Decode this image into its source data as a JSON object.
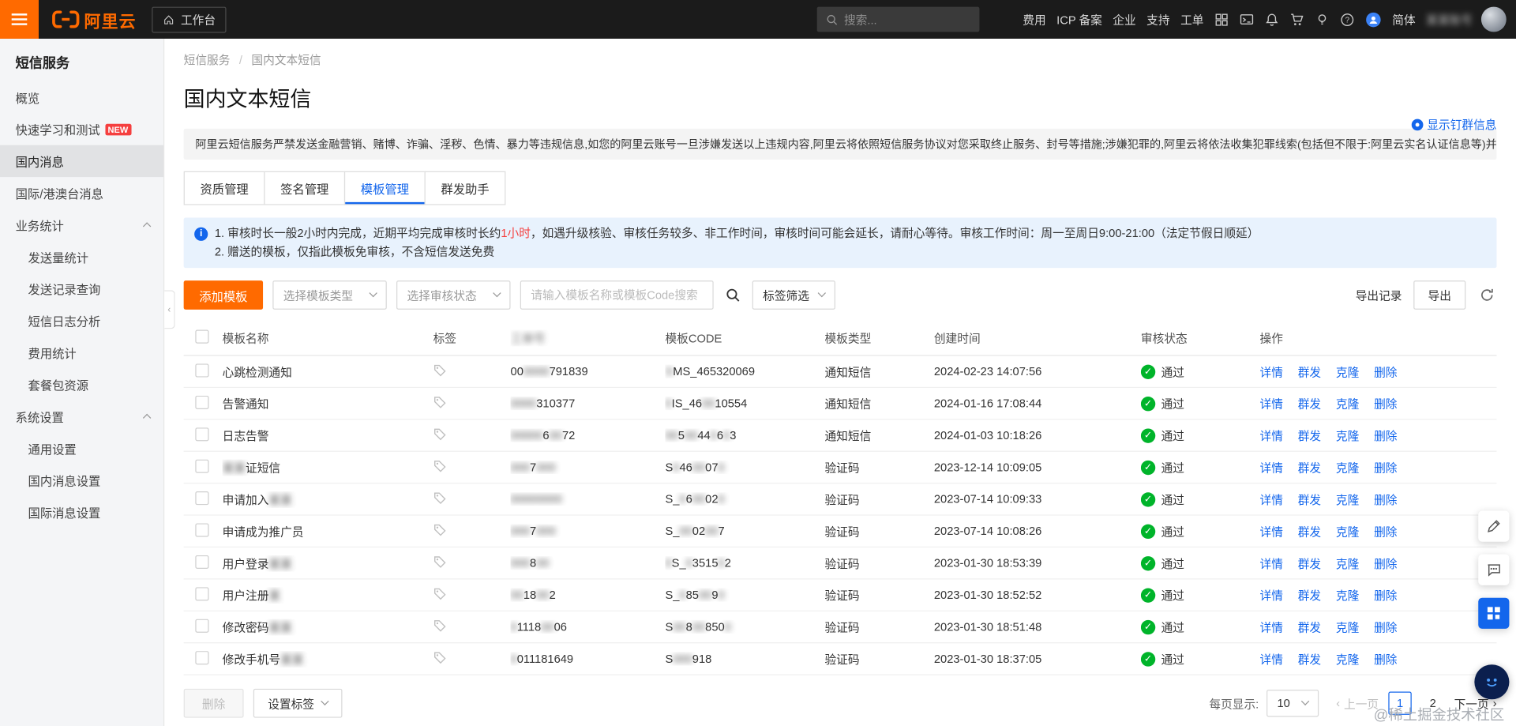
{
  "colors": {
    "brand_orange": "#ff6a00",
    "link_blue": "#1366ec",
    "success_green": "#00b42a",
    "alert_red": "#f53f3f",
    "topbar_bg": "#1b1b1b",
    "infobox_bg": "#e8f2fd"
  },
  "icons": {
    "check": "✓",
    "prev": "‹",
    "next": "›",
    "collapse": "‹"
  },
  "topbar": {
    "logo": "阿里云",
    "workspace": "工作台",
    "search_placeholder": "搜索...",
    "links": [
      "费用",
      "ICP 备案",
      "企业",
      "支持",
      "工单"
    ],
    "lang": "简体",
    "username": "某某账号"
  },
  "sidebar": {
    "title": "短信服务",
    "items": [
      {
        "label": "概览"
      },
      {
        "label": "快速学习和测试",
        "badge": "NEW"
      },
      {
        "label": "国内消息",
        "cls": "selected"
      },
      {
        "label": "国际/港澳台消息"
      },
      {
        "label": "业务统计",
        "cls": "group",
        "chev": true
      },
      {
        "label": "发送量统计",
        "cls": "sub"
      },
      {
        "label": "发送记录查询",
        "cls": "sub"
      },
      {
        "label": "短信日志分析",
        "cls": "sub"
      },
      {
        "label": "费用统计",
        "cls": "sub"
      },
      {
        "label": "套餐包资源",
        "cls": "sub"
      },
      {
        "label": "系统设置",
        "cls": "group",
        "chev": true
      },
      {
        "label": "通用设置",
        "cls": "sub"
      },
      {
        "label": "国内消息设置",
        "cls": "sub"
      },
      {
        "label": "国际消息设置",
        "cls": "sub"
      }
    ]
  },
  "breadcrumb": {
    "items": [
      "短信服务",
      "国内文本短信"
    ],
    "sep": "/"
  },
  "page": {
    "title": "国内文本短信",
    "ding_link": "显示钉群信息"
  },
  "notice": {
    "text": "阿里云短信服务严禁发送金融营销、赌博、诈骗、淫秽、色情、暴力等违规信息,如您的阿里云账号一旦涉嫌发送以上违规内容,阿里云将依照短信服务协议对您采取终止服务、封号等措施;涉嫌犯罪的,阿里云将依法收集犯罪线索(包括但不限于:阿里云实名认证信息等)并移交公安机关处理。"
  },
  "tabs": {
    "items": [
      {
        "label": "资质管理"
      },
      {
        "label": "签名管理"
      },
      {
        "label": "模板管理",
        "cls": "active"
      },
      {
        "label": "群发助手"
      }
    ]
  },
  "infobox": {
    "lines": [
      [
        "1. 审核时长一般2小时内完成，近期平均完成审核时长约",
        {
          "t": "1小时",
          "cls": "red"
        },
        "，如遇升级核验、审核任务较多、非工作时间，审核时间可能会延长，请耐心等待。审核工作时间：周一至周日9:00-21:00（法定节假日顺延）"
      ],
      [
        "2. 赠送的模板，仅指此模板免审核，不含短信发送免费"
      ]
    ]
  },
  "toolbar": {
    "add": "添加模板",
    "type_placeholder": "选择模板类型",
    "status_placeholder": "选择审核状态",
    "search_placeholder": "请输入模板名称或模板Code搜索",
    "tag_filter": "标签筛选",
    "export_record": "导出记录",
    "export": "导出"
  },
  "table": {
    "columns": [
      "模板名称",
      "标签",
      "工单号",
      "模板CODE",
      "模板类型",
      "创建时间",
      "审核状态",
      "操作"
    ],
    "actions": [
      "详情",
      "群发",
      "克隆",
      "删除"
    ],
    "rows": [
      {
        "name": [
          "心跳检测通知"
        ],
        "order": [
          "00",
          {
            "t": "0000",
            "cls": "blurred"
          },
          "791839"
        ],
        "code": [
          {
            "t": "S",
            "cls": "blurred"
          },
          "MS_465320069"
        ],
        "type": "通知短信",
        "created": "2024-02-23 14:07:56",
        "status": "通过"
      },
      {
        "name": [
          "告警通知"
        ],
        "order": [
          {
            "t": "0000",
            "cls": "blurred"
          },
          "310377"
        ],
        "code": [
          {
            "t": "0",
            "cls": "blurred"
          },
          "IS_46",
          {
            "t": "00",
            "cls": "blurred"
          },
          "10554"
        ],
        "type": "通知短信",
        "created": "2024-01-16 17:08:44",
        "status": "通过"
      },
      {
        "name": [
          "日志告警"
        ],
        "order": [
          {
            "t": "00000",
            "cls": "blurred"
          },
          "6",
          {
            "t": "00",
            "cls": "blurred"
          },
          "72"
        ],
        "code": [
          {
            "t": "00",
            "cls": "blurred"
          },
          "5",
          {
            "t": "00",
            "cls": "blurred"
          },
          "44",
          {
            "t": "0",
            "cls": "blurred"
          },
          "6",
          {
            "t": "0",
            "cls": "blurred"
          },
          "3"
        ],
        "type": "通知短信",
        "created": "2024-01-03 10:18:26",
        "status": "通过"
      },
      {
        "name": [
          {
            "t": "某某",
            "cls": "blurred"
          },
          "证短信"
        ],
        "order": [
          {
            "t": "000",
            "cls": "blurred"
          },
          "7",
          {
            "t": "000",
            "cls": "blurred"
          }
        ],
        "code": [
          "S",
          {
            "t": "0",
            "cls": "blurred"
          },
          "46",
          {
            "t": "00",
            "cls": "blurred"
          },
          "07",
          {
            "t": "0",
            "cls": "blurred"
          }
        ],
        "type": "验证码",
        "created": "2023-12-14 10:09:05",
        "status": "通过"
      },
      {
        "name": [
          "申请加入",
          {
            "t": "某某",
            "cls": "blurred"
          }
        ],
        "order": [
          {
            "t": "00000000",
            "cls": "blurred"
          }
        ],
        "code": [
          "S_",
          {
            "t": "0",
            "cls": "blurred"
          },
          "6",
          {
            "t": "00",
            "cls": "blurred"
          },
          "02",
          {
            "t": "0",
            "cls": "blurred"
          }
        ],
        "type": "验证码",
        "created": "2023-07-14 10:09:33",
        "status": "通过"
      },
      {
        "name": [
          "申请成为推广员"
        ],
        "order": [
          {
            "t": "000",
            "cls": "blurred"
          },
          "7",
          {
            "t": "000",
            "cls": "blurred"
          }
        ],
        "code": [
          "S_",
          {
            "t": "00",
            "cls": "blurred"
          },
          "02",
          {
            "t": "00",
            "cls": "blurred"
          },
          "7"
        ],
        "type": "验证码",
        "created": "2023-07-14 10:08:26",
        "status": "通过"
      },
      {
        "name": [
          "用户登录",
          {
            "t": "某某",
            "cls": "blurred"
          }
        ],
        "order": [
          {
            "t": "000",
            "cls": "blurred"
          },
          "8",
          {
            "t": "00",
            "cls": "blurred"
          }
        ],
        "code": [
          {
            "t": "0",
            "cls": "blurred"
          },
          "S_",
          {
            "t": "0",
            "cls": "blurred"
          },
          "3515",
          {
            "t": "0",
            "cls": "blurred"
          },
          "2"
        ],
        "type": "验证码",
        "created": "2023-01-30 18:53:39",
        "status": "通过"
      },
      {
        "name": [
          "用户注册",
          {
            "t": "某",
            "cls": "blurred"
          }
        ],
        "order": [
          {
            "t": "00",
            "cls": "blurred"
          },
          "18",
          {
            "t": "00",
            "cls": "blurred"
          },
          "2"
        ],
        "code": [
          "S_",
          {
            "t": "0",
            "cls": "blurred"
          },
          "85",
          {
            "t": "00",
            "cls": "blurred"
          },
          "9",
          {
            "t": "0",
            "cls": "blurred"
          }
        ],
        "type": "验证码",
        "created": "2023-01-30 18:52:52",
        "status": "通过"
      },
      {
        "name": [
          "修改密码",
          {
            "t": "某某",
            "cls": "blurred"
          }
        ],
        "order": [
          {
            "t": "0",
            "cls": "blurred"
          },
          "1118",
          {
            "t": "00",
            "cls": "blurred"
          },
          "06"
        ],
        "code": [
          "S",
          {
            "t": "00",
            "cls": "blurred"
          },
          "8",
          {
            "t": "00",
            "cls": "blurred"
          },
          "850",
          {
            "t": "0",
            "cls": "blurred"
          }
        ],
        "type": "验证码",
        "created": "2023-01-30 18:51:48",
        "status": "通过"
      },
      {
        "name": [
          "修改手机号",
          {
            "t": "某某",
            "cls": "blurred"
          }
        ],
        "order": [
          {
            "t": "0",
            "cls": "blurred"
          },
          "011181649"
        ],
        "code": [
          "S",
          {
            "t": "000",
            "cls": "blurred"
          },
          "918"
        ],
        "type": "验证码",
        "created": "2023-01-30 18:37:05",
        "status": "通过"
      }
    ]
  },
  "footer": {
    "delete": "删除",
    "set_tag": "设置标签",
    "per_page_label": "每页显示:",
    "per_page": "10",
    "prev": "上一页",
    "next": "下一页",
    "pages": [
      "1",
      "2"
    ]
  },
  "watermark": "@稀土掘金技术社区"
}
